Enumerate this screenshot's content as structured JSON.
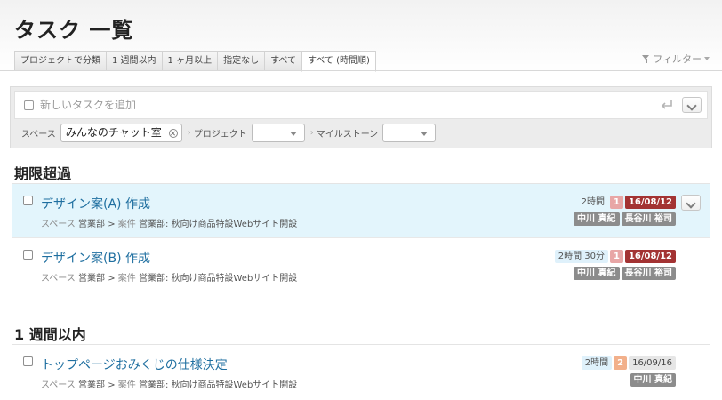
{
  "page": {
    "title": "タスク 一覧"
  },
  "tabs": [
    {
      "label": "プロジェクトで分類",
      "active": false
    },
    {
      "label": "1 週間以内",
      "active": false
    },
    {
      "label": "1 ヶ月以上",
      "active": false
    },
    {
      "label": "指定なし",
      "active": false
    },
    {
      "label": "すべて",
      "active": false
    },
    {
      "label": "すべて (時間順)",
      "active": true
    }
  ],
  "filter": {
    "label": "フィルター"
  },
  "add_task": {
    "placeholder": "新しいタスクを追加",
    "space_label": "スペース",
    "space_value": "みんなのチャット室",
    "project_label": "プロジェクト",
    "milestone_label": "マイルストーン"
  },
  "sections": [
    {
      "title": "期限超過",
      "tasks": [
        {
          "title": "デザイン案(A) 作成",
          "space_label": "スペース",
          "space": "営業部",
          "sep": ">",
          "case_label": "案件",
          "case": "営業部: 秋向け商品特設Webサイト開設",
          "time": "2時間",
          "priority": "1",
          "due": "16/08/12",
          "users": [
            "中川 真紀",
            "長谷川 裕司"
          ]
        },
        {
          "title": "デザイン案(B) 作成",
          "space_label": "スペース",
          "space": "営業部",
          "sep": ">",
          "case_label": "案件",
          "case": "営業部: 秋向け商品特設Webサイト開設",
          "time": "2時間 30分",
          "priority": "1",
          "due": "16/08/12",
          "users": [
            "中川 真紀",
            "長谷川 裕司"
          ]
        }
      ]
    },
    {
      "title": "1 週間以内",
      "tasks": [
        {
          "title": "トップページおみくじの仕様決定",
          "space_label": "スペース",
          "space": "営業部",
          "sep": ">",
          "case_label": "案件",
          "case": "営業部: 秋向け商品特設Webサイト開設",
          "time": "2時間",
          "priority": "2",
          "due": "16/09/16",
          "users": [
            "中川 真紀"
          ]
        }
      ]
    }
  ],
  "colors": {
    "link": "#1f6fa0",
    "overdue": "#a33333",
    "hover_row": "#e3f5fc",
    "user_badge": "#8c8c8c"
  }
}
